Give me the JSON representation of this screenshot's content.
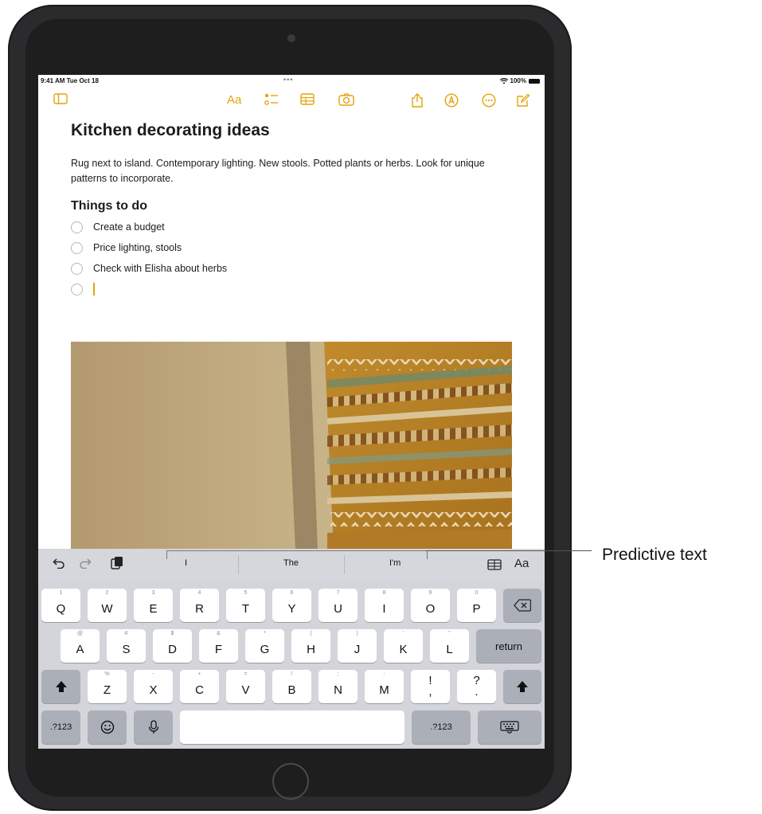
{
  "status_bar": {
    "time": "9:41 AM  Tue Oct 18",
    "dots": "•••",
    "battery": "100%"
  },
  "toolbar": {
    "format_label": "Aa"
  },
  "note": {
    "title": "Kitchen decorating ideas",
    "body": "Rug next to island. Contemporary lighting. New stools. Potted plants or herbs. Look for unique patterns to incorporate.",
    "heading": "Things to do",
    "checklist": [
      "Create a budget",
      "Price lighting, stools",
      "Check with Elisha about herbs"
    ]
  },
  "predictive": {
    "suggestions": [
      "I",
      "The",
      "I'm"
    ],
    "format_label": "Aa"
  },
  "keyboard": {
    "row1": [
      [
        "1",
        "Q"
      ],
      [
        "2",
        "W"
      ],
      [
        "3",
        "E"
      ],
      [
        "4",
        "R"
      ],
      [
        "5",
        "T"
      ],
      [
        "6",
        "Y"
      ],
      [
        "7",
        "U"
      ],
      [
        "8",
        "I"
      ],
      [
        "9",
        "O"
      ],
      [
        "0",
        "P"
      ]
    ],
    "row2": [
      [
        "@",
        "A"
      ],
      [
        "#",
        "S"
      ],
      [
        "$",
        "D"
      ],
      [
        "&",
        "F"
      ],
      [
        "*",
        "G"
      ],
      [
        "(",
        "H"
      ],
      [
        ")",
        "J"
      ],
      [
        "'",
        "K"
      ],
      [
        "\"",
        "L"
      ]
    ],
    "row3": [
      [
        "%",
        "Z"
      ],
      [
        "-",
        "X"
      ],
      [
        "+",
        "C"
      ],
      [
        "=",
        "V"
      ],
      [
        "/",
        "B"
      ],
      [
        ";",
        "N"
      ],
      [
        ":",
        "M"
      ]
    ],
    "punct1": {
      "top": "!",
      "bottom": ","
    },
    "punct2": {
      "top": "?",
      "bottom": "."
    },
    "return_label": "return",
    "numbers_label": ".?123"
  },
  "callout": {
    "label": "Predictive text"
  },
  "colors": {
    "accent": "#e4a40b",
    "keyboard_bg": "#d3d5db"
  }
}
